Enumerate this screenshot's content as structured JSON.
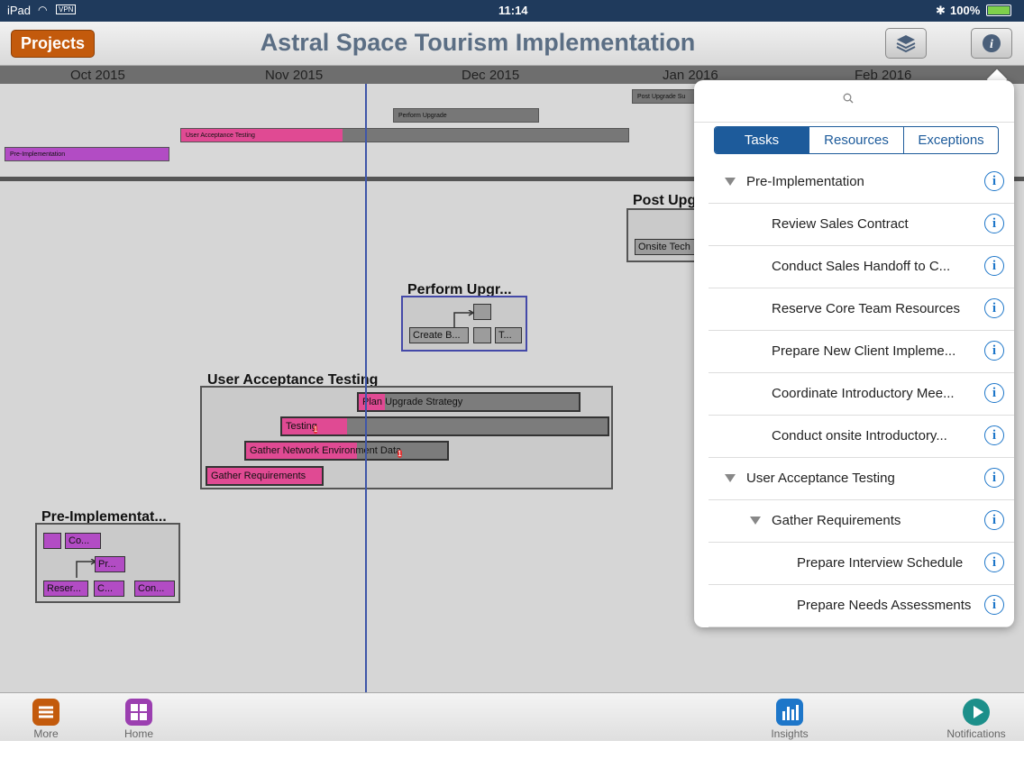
{
  "status_bar": {
    "device": "iPad",
    "vpn": "VPN",
    "time": "11:14",
    "battery": "100%"
  },
  "header": {
    "projects_button": "Projects",
    "title": "Astral Space Tourism Implementation",
    "layers_icon": "layers-icon",
    "info_icon": "info-icon"
  },
  "timeline": {
    "months": [
      "Oct 2015",
      "Nov 2015",
      "Dec 2015",
      "Jan 2016",
      "Feb 2016"
    ],
    "overview_bars": [
      {
        "label": "Post Upgrade Su",
        "progress": 0
      },
      {
        "label": "Perform Upgrade",
        "progress": 0
      },
      {
        "label": "User Acceptance Testing",
        "progress": 0.36
      },
      {
        "label": "Pre-Implementation",
        "progress": 1.0
      }
    ]
  },
  "canvas": {
    "post_upgrade": {
      "title": "Post Upg",
      "task": "Onsite Tech"
    },
    "perform_upgrade": {
      "title": "Perform Upgr...",
      "tasks": [
        "Create B...",
        "",
        "T..."
      ]
    },
    "uat": {
      "title": "User Acceptance Testing",
      "tasks": [
        {
          "label": "Plan Upgrade Strategy",
          "progress": 0.12,
          "badge": ""
        },
        {
          "label": "Testing",
          "progress": 0.2,
          "badge": "1"
        },
        {
          "label": "Gather Network Environment Data",
          "progress": 0.55,
          "badge": "1"
        },
        {
          "label": "Gather Requirements",
          "progress": 1.0,
          "badge": ""
        }
      ]
    },
    "pre_impl": {
      "title": "Pre-Implementat...",
      "tasks": [
        "Co...",
        "Pr...",
        "Reser...",
        "C...",
        "Con..."
      ]
    }
  },
  "popover": {
    "search_icon": "search-icon",
    "tabs": [
      "Tasks",
      "Resources",
      "Exceptions"
    ],
    "active_tab": "Tasks",
    "rows": [
      {
        "label": "Pre-Implementation",
        "indent": 0,
        "expandable": true
      },
      {
        "label": "Review Sales Contract",
        "indent": 1,
        "expandable": false
      },
      {
        "label": "Conduct Sales Handoff to C...",
        "indent": 1,
        "expandable": false
      },
      {
        "label": "Reserve Core Team Resources",
        "indent": 1,
        "expandable": false
      },
      {
        "label": "Prepare New Client Impleme...",
        "indent": 1,
        "expandable": false
      },
      {
        "label": "Coordinate Introductory Mee...",
        "indent": 1,
        "expandable": false
      },
      {
        "label": "Conduct onsite Introductory...",
        "indent": 1,
        "expandable": false
      },
      {
        "label": "User Acceptance Testing",
        "indent": 0,
        "expandable": true
      },
      {
        "label": "Gather Requirements",
        "indent": 1,
        "expandable": true
      },
      {
        "label": "Prepare Interview Schedule",
        "indent": 2,
        "expandable": false
      },
      {
        "label": "Prepare Needs Assessments",
        "indent": 2,
        "expandable": false
      }
    ],
    "info_glyph": "i"
  },
  "tab_bar": {
    "items": [
      {
        "label": "More",
        "icon": "more-icon",
        "color": "#c35a0c"
      },
      {
        "label": "Home",
        "icon": "home-grid-icon",
        "color": "#9b3fb0"
      },
      {
        "label": "Insights",
        "icon": "insights-chart-icon",
        "color": "#1d76c9"
      },
      {
        "label": "Notifications",
        "icon": "notifications-play-icon",
        "color": "#1c8f8a"
      }
    ]
  }
}
